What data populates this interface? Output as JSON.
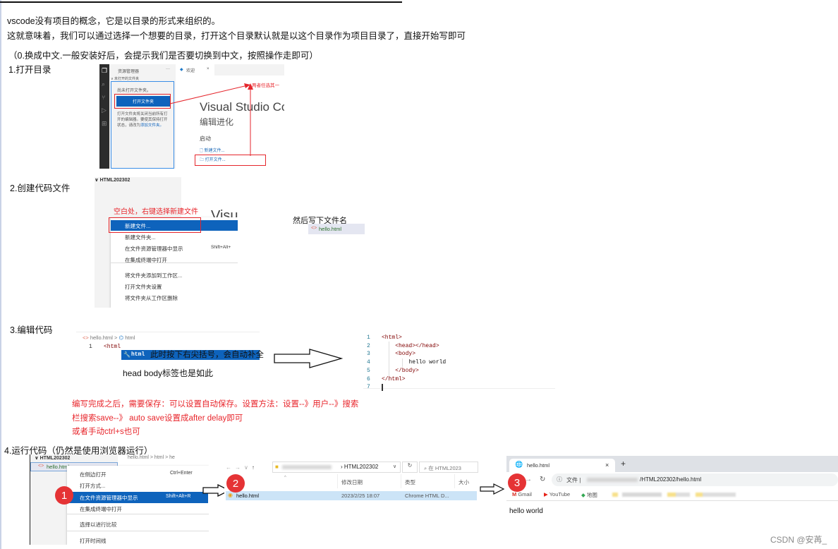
{
  "intro": {
    "line1": "vscode没有项目的概念，它是以目录的形式来组织的。",
    "line2": "这就意味着，我们可以通过选择一个想要的目录，打开这个目录默认就是以这个目录作为项目目录了，直接开始写即可",
    "note": "（0.换成中文.一般安装好后，会提示我们是否要切换到中文，按照操作走即可）"
  },
  "step1": {
    "title": "1.打开目录",
    "sidebar_title": "资源管理器",
    "section": "∨ 未打开的文件夹",
    "no_folder": "尚未打开文件夹。",
    "open_folder_button": "打开文件夹",
    "desc": "打开文件夹将关闭当前所有打开的编辑器。要使其保持打开状态，请改为",
    "desc_link": "添加文件夹。",
    "tab_label": "欢迎",
    "annotation": "两者任选其一",
    "welcome_title": "Visual Studio Code",
    "welcome_sub": "编辑进化",
    "start_label": "启动",
    "new_file": "新建文件...",
    "open_file": "打开文件..."
  },
  "step2": {
    "title": "2.创建代码文件",
    "folder": "∨ HTML202302",
    "annotation": "空白处，右键选择新建文件",
    "bg_text": "Visu",
    "menu": [
      {
        "label": "新建文件...",
        "shortcut": "",
        "selected": true
      },
      {
        "label": "新建文件夹...",
        "shortcut": "",
        "selected": false
      },
      {
        "label": "在文件资源管理器中显示",
        "shortcut": "Shift+Alt+",
        "selected": false
      },
      {
        "label": "在集成终端中打开",
        "shortcut": "",
        "selected": false
      },
      {
        "label": "将文件夹添加到工作区...",
        "shortcut": "",
        "selected": false
      },
      {
        "label": "打开文件夹设置",
        "shortcut": "",
        "selected": false
      },
      {
        "label": "将文件夹从工作区删除",
        "shortcut": "",
        "selected": false
      }
    ],
    "then_label": "然后写下文件名",
    "filename": "hello.html"
  },
  "step3": {
    "title": "3.编辑代码",
    "breadcrumb_file": "hello.html",
    "breadcrumb_sep": ">",
    "breadcrumb_tag": "html",
    "line_no": "1",
    "typed": "<html",
    "suggestion": "html",
    "annotation": "此时按下右尖括号，会自动补全",
    "head_body_note": "head body标签也是如此",
    "code_lines": [
      {
        "no": "1",
        "text": "<html>"
      },
      {
        "no": "2",
        "text": "    <head></head>"
      },
      {
        "no": "3",
        "text": "    <body>"
      },
      {
        "no": "4",
        "text": "        hello world"
      },
      {
        "no": "5",
        "text": "    </body>"
      },
      {
        "no": "6",
        "text": "</html>"
      },
      {
        "no": "7",
        "text": ""
      }
    ],
    "save_note_1": "编写完成之后，需要保存：可以设置自动保存。设置方法：设置--》用户--》搜索",
    "save_note_2": "栏搜索save--》 auto save设置成after delay即可",
    "save_note_3": "或者手动ctrl+s也可"
  },
  "step4": {
    "title": "4.运行代码（仍然是使用浏览器运行）",
    "folder": "∨ HTML202302",
    "file": "hello.html",
    "breadcrumb": "hello.html > html > he",
    "menu": [
      {
        "label": "在侧边打开",
        "shortcut": "Ctrl+Enter",
        "selected": false
      },
      {
        "label": "打开方式...",
        "shortcut": "",
        "selected": false
      },
      {
        "label": "在文件资源管理器中显示",
        "shortcut": "Shift+Alt+R",
        "selected": true
      },
      {
        "label": "在集成终端中打开",
        "shortcut": "",
        "selected": false
      },
      {
        "label": "选择以进行比较",
        "shortcut": "",
        "selected": false
      },
      {
        "label": "打开时间线",
        "shortcut": "",
        "selected": false
      }
    ],
    "badges": [
      "1",
      "2",
      "3"
    ],
    "explorer": {
      "path": "HTML202302",
      "search_placeholder": "在 HTML2023",
      "columns": [
        "修改日期",
        "类型",
        "大小"
      ],
      "row": {
        "name": "hello.html",
        "date": "2023/2/25 18:07",
        "type": "Chrome HTML D..."
      }
    },
    "browser": {
      "tab_title": "hello.html",
      "new_tab": "+",
      "close": "×",
      "url_prefix": "文件 |",
      "url": "/HTML202302/hello.html",
      "bookmarks": [
        "Gmail",
        "YouTube",
        "地图"
      ],
      "page_text": "hello world"
    }
  },
  "watermark": "CSDN @安苒_"
}
